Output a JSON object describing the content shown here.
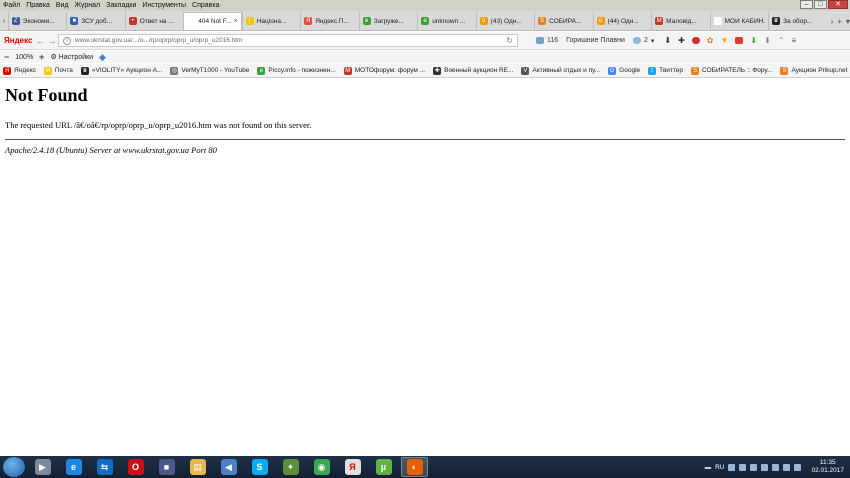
{
  "menu": [
    "Файл",
    "Правка",
    "Вид",
    "Журнал",
    "Закладки",
    "Инструменты",
    "Справка"
  ],
  "window_controls": {
    "minimize": "–",
    "maximize": "□",
    "close": "✕"
  },
  "tabs": [
    {
      "title": "Экономи...",
      "color": "#3b5998",
      "glyph": "Z"
    },
    {
      "title": "ЗСУ доб...",
      "color": "#2b5fb3",
      "glyph": "■"
    },
    {
      "title": "Ответ на ...",
      "color": "#c0392b",
      "glyph": "•"
    },
    {
      "title": "404 Not F...",
      "color": "#ffffff",
      "glyph": "",
      "active": true
    },
    {
      "title": "Націона...",
      "color": "#f1c40f",
      "glyph": "|"
    },
    {
      "title": "Яндекс.П...",
      "color": "#e74c3c",
      "glyph": "Я"
    },
    {
      "title": "Загруже...",
      "color": "#3aa23a",
      "glyph": "e"
    },
    {
      "title": "unknown ...",
      "color": "#3aa23a",
      "glyph": "e"
    },
    {
      "title": "(43) Одн...",
      "color": "#f39c12",
      "glyph": "о"
    },
    {
      "title": "СОБИРА...",
      "color": "#e67e22",
      "glyph": "S"
    },
    {
      "title": "(44) Одн...",
      "color": "#f39c12",
      "glyph": "о"
    },
    {
      "title": "Маловід...",
      "color": "#c0392b",
      "glyph": "M"
    },
    {
      "title": "МОЙ КАБИН...",
      "color": "#ffffff",
      "glyph": ""
    },
    {
      "title": "За обор...",
      "color": "#222222",
      "glyph": "♛"
    }
  ],
  "navbar": {
    "brand": "Яндекс",
    "url": "www.ukrstat.gov.ua/.../o.../rp/oprp/oprp_u/oprp_u2016.htm",
    "mail_count": "116",
    "location": "Горишние Плавни",
    "weather": "2"
  },
  "zoom": {
    "level": "100%",
    "settings_label": "Настройки"
  },
  "bookmarks": [
    {
      "label": "Яндекс",
      "color": "#e30000",
      "glyph": "Я"
    },
    {
      "label": "Почта",
      "color": "#f1c40f",
      "glyph": "✉"
    },
    {
      "label": "«VIOLITY» Аукцион А...",
      "color": "#222222",
      "glyph": "♛"
    },
    {
      "label": "VerMyT1000 - YouTube",
      "color": "#777777",
      "glyph": "◎"
    },
    {
      "label": "Piccy.info - пожизнен...",
      "color": "#3aa23a",
      "glyph": "e"
    },
    {
      "label": "МОТОфорум: форум ...",
      "color": "#c0392b",
      "glyph": "M"
    },
    {
      "label": "Военный аукцион RE...",
      "color": "#333333",
      "glyph": "✚"
    },
    {
      "label": "Активный отдых и пу...",
      "color": "#555555",
      "glyph": "V"
    },
    {
      "label": "Google",
      "color": "#4285f4",
      "glyph": "G"
    },
    {
      "label": "Твиттер",
      "color": "#1da1f2",
      "glyph": "t"
    },
    {
      "label": "СОБИРАТЕЛЬ :: Фору...",
      "color": "#e67e22",
      "glyph": "S"
    },
    {
      "label": "Аукцион Prikup.net",
      "color": "#e67e22",
      "glyph": "S"
    }
  ],
  "page": {
    "heading": "Not Found",
    "message": "The requested URL /â€/oâ€/rp/oprp/oprp_u/oprp_u2016.htm was not found on this server.",
    "server_signature": "Apache/2.4.18 (Ubuntu) Server at www.ukrstat.gov.ua Port 80"
  },
  "taskbar": {
    "apps": [
      {
        "name": "media-player",
        "color": "#7d8a9b",
        "glyph": "▶"
      },
      {
        "name": "internet-explorer",
        "color": "#1e88e5",
        "glyph": "e"
      },
      {
        "name": "teamviewer",
        "color": "#0e6ec7",
        "glyph": "⇆"
      },
      {
        "name": "opera",
        "color": "#cc0f16",
        "glyph": "O"
      },
      {
        "name": "save-floppy",
        "color": "#4a5a86",
        "glyph": "■"
      },
      {
        "name": "file-explorer",
        "color": "#e8b84a",
        "glyph": "▤"
      },
      {
        "name": "volume",
        "color": "#4b80c3",
        "glyph": "◀"
      },
      {
        "name": "skype",
        "color": "#00aff0",
        "glyph": "S"
      },
      {
        "name": "games",
        "color": "#5b8f3a",
        "glyph": "✦"
      },
      {
        "name": "chrome",
        "color": "#3aa757",
        "glyph": "◉"
      },
      {
        "name": "yandex-browser",
        "color": "#e0e0e0",
        "glyph": "Я"
      },
      {
        "name": "utorrent",
        "color": "#62b346",
        "glyph": "µ"
      },
      {
        "name": "firefox",
        "color": "#e66000",
        "glyph": "◐",
        "active": true
      }
    ],
    "lang": "RU",
    "time": "11:35",
    "date": "02.01.2017"
  }
}
